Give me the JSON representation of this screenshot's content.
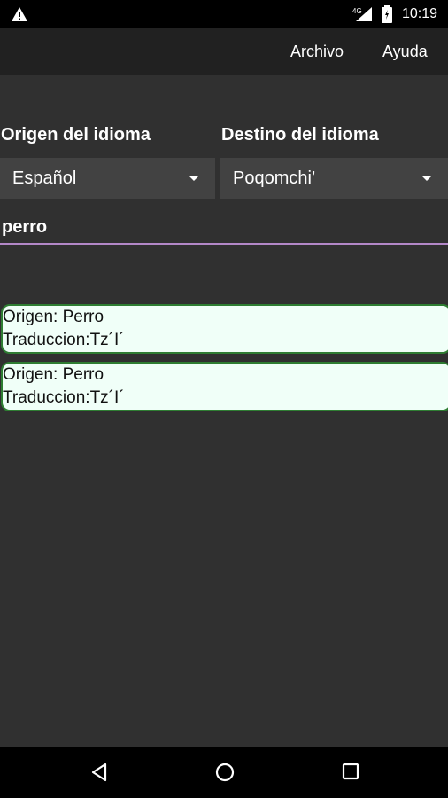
{
  "status_bar": {
    "time": "10:19",
    "icons": [
      "warning-icon",
      "signal-4g-icon",
      "battery-icon"
    ]
  },
  "app_bar": {
    "menu": [
      "Archivo",
      "Ayuda"
    ]
  },
  "source_language": {
    "label": "Origen del idioma",
    "selected": "Español"
  },
  "target_language": {
    "label": "Destino del idioma",
    "selected": "Poqomchi’"
  },
  "search": {
    "value": "perro"
  },
  "results": [
    {
      "origin": "Origen: Perro",
      "translation": "Traduccion:Tz´I´"
    },
    {
      "origin": "Origen: Perro",
      "translation": "Traduccion:Tz´I´"
    }
  ],
  "nav_bar": {
    "icons": [
      "back-icon",
      "home-icon",
      "recents-icon"
    ]
  },
  "colors": {
    "background": "#303030",
    "app_bar": "#212121",
    "card_background": "#f0fff8",
    "card_border": "#2e7d32",
    "input_underline": "#b388c8"
  }
}
